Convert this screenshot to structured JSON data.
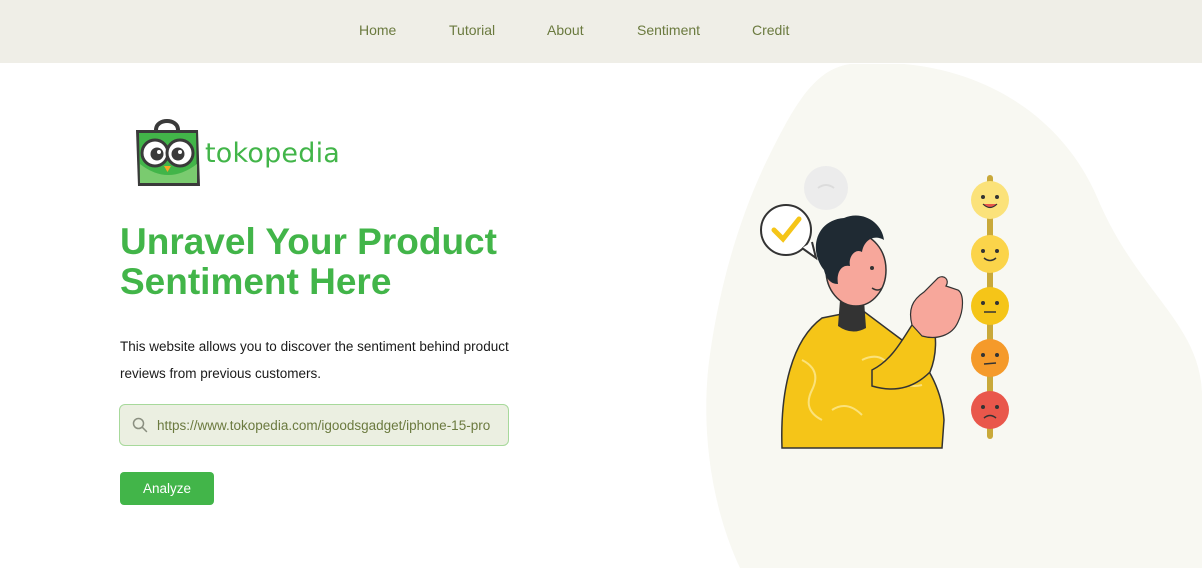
{
  "nav": {
    "items": [
      {
        "label": "Home"
      },
      {
        "label": "Tutorial"
      },
      {
        "label": "About"
      },
      {
        "label": "Sentiment"
      },
      {
        "label": "Credit"
      }
    ]
  },
  "brand": {
    "name": "tokopedia",
    "color": "#42b549"
  },
  "hero": {
    "title": "Unravel Your Product Sentiment Here",
    "description": "This website allows you to discover the sentiment behind product reviews from previous customers."
  },
  "search": {
    "value": "https://www.tokopedia.com/igoodsgadget/iphone-15-pro",
    "icon": "search-icon"
  },
  "actions": {
    "analyze_label": "Analyze"
  },
  "colors": {
    "accent": "#42b549",
    "navbar_bg": "#efeee7",
    "nav_text": "#6b7a3f",
    "blob_bg": "#f8f8f2"
  },
  "illustration": {
    "description_icon": "sentiment-rating-illustration",
    "emoji_scale": [
      "happy",
      "smile",
      "neutral",
      "unhappy",
      "sad"
    ]
  }
}
